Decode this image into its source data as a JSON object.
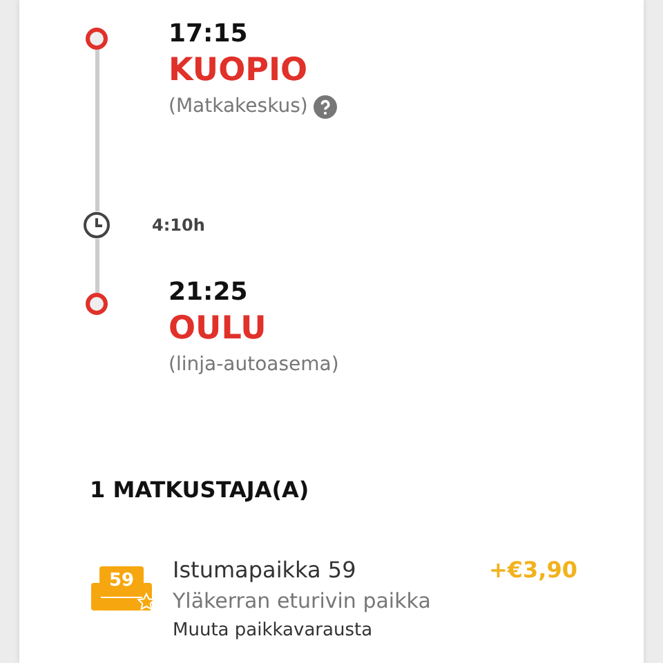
{
  "journey": {
    "departure": {
      "time": "17:15",
      "city": "KUOPIO",
      "station": "(Matkakeskus)",
      "info": true
    },
    "duration": "4:10h",
    "arrival": {
      "time": "21:25",
      "city": "OULU",
      "station": "(linja-autoasema)"
    }
  },
  "passengers": {
    "heading": "1 MATKUSTAJA(A)",
    "seat": {
      "number": "59",
      "title": "Istumapaikka 59",
      "description": "Yläkerran eturivin paikka",
      "price": "+€3,90",
      "link": "Muuta paikkavarausta"
    }
  }
}
